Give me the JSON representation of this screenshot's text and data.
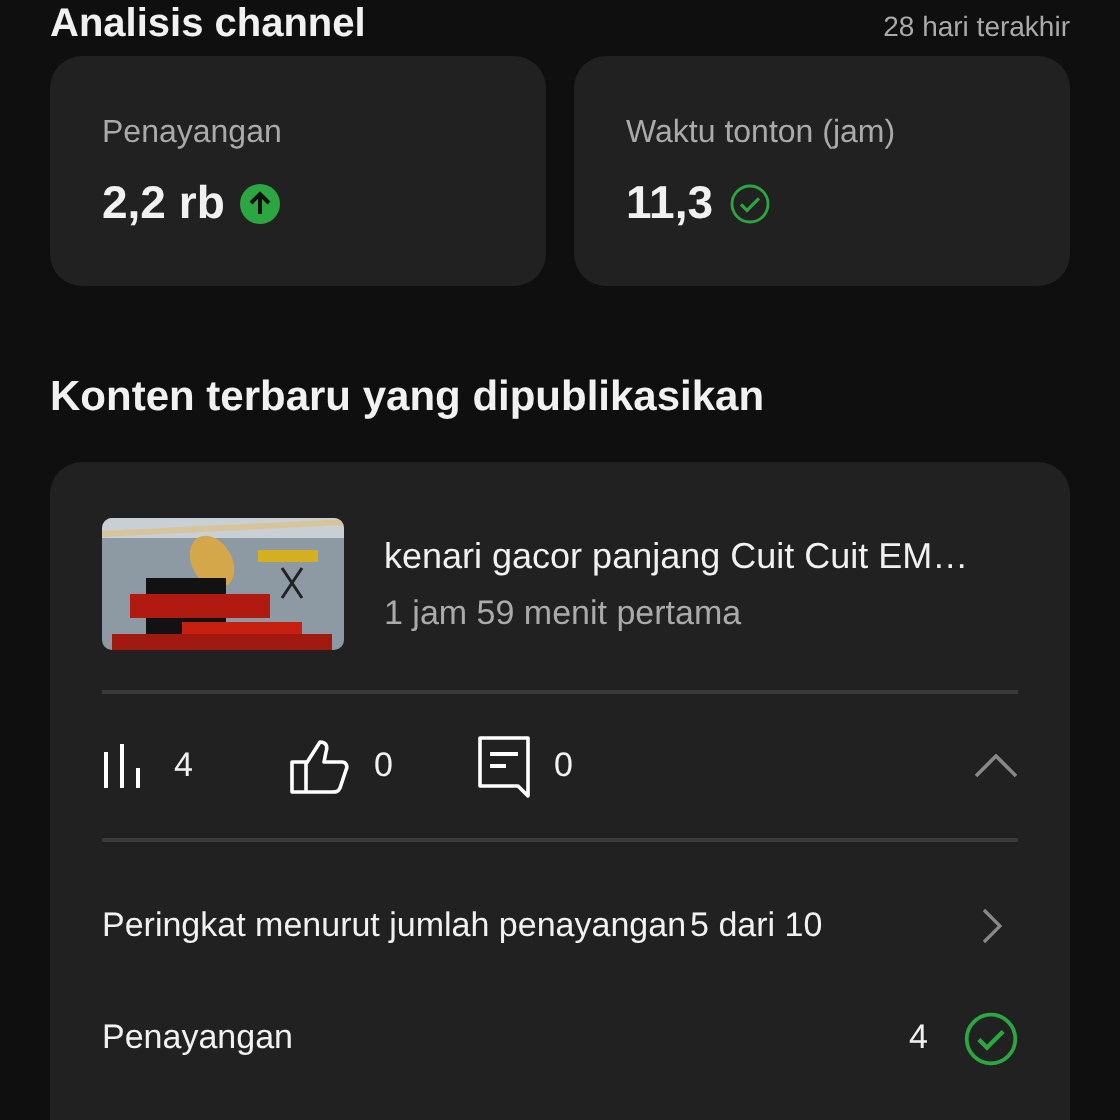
{
  "header": {
    "title": "Analisis channel",
    "period": "28 hari terakhir"
  },
  "metrics": [
    {
      "label": "Penayangan",
      "value": "2,2 rb",
      "kind": "up"
    },
    {
      "label": "Waktu tonton (jam)",
      "value": "11,3",
      "kind": "check"
    }
  ],
  "latest": {
    "heading": "Konten terbaru yang dipublikasikan",
    "video": {
      "title": "kenari gacor panjang Cuit Cuit EM…",
      "subtitle": "1 jam 59 menit pertama"
    },
    "stats": [
      {
        "kind": "views",
        "value": "4"
      },
      {
        "kind": "likes",
        "value": "0"
      },
      {
        "kind": "comments",
        "value": "0"
      }
    ],
    "expanded": true,
    "rows": [
      {
        "kind": "link",
        "label": "Peringkat menurut jumlah penayangan",
        "value": "5 dari 10"
      },
      {
        "kind": "check",
        "label": "Penayangan",
        "value": "4"
      }
    ]
  }
}
